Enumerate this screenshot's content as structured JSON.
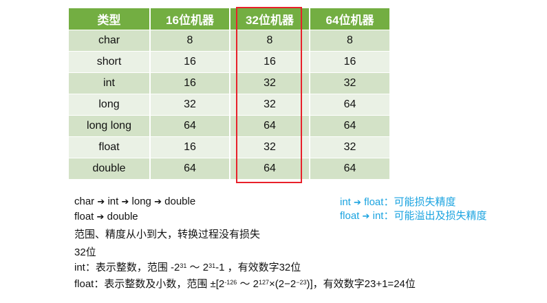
{
  "table": {
    "headers": [
      "类型",
      "16位机器",
      "32位机器",
      "64位机器"
    ],
    "rows": [
      [
        "char",
        "8",
        "8",
        "8"
      ],
      [
        "short",
        "16",
        "16",
        "16"
      ],
      [
        "int",
        "16",
        "32",
        "32"
      ],
      [
        "long",
        "32",
        "32",
        "64"
      ],
      [
        "long long",
        "64",
        "64",
        "64"
      ],
      [
        "float",
        "16",
        "32",
        "32"
      ],
      [
        "double",
        "64",
        "64",
        "64"
      ]
    ],
    "highlight_color": "#e8202a",
    "header_color": "#73ae42"
  },
  "notes": {
    "conv1": [
      "char",
      "int",
      "long",
      "double"
    ],
    "conv2": [
      "float",
      "double"
    ],
    "range_line": "范围、精度从小到大，转换过程没有损失",
    "bits_heading": "32位",
    "int_line": {
      "prefix": "int：表示整数，范围 -2",
      "exp1": "31",
      "mid": " ～ 2",
      "exp2": "31",
      "suffix": "-1 ，有效数字32位"
    },
    "float_line": {
      "prefix": "float：表示整数及小数，范围 ±[2",
      "exp1": "-126",
      "mid": " ～ 2",
      "exp2": "127",
      "mid2": "×(2−2",
      "exp3": "−23",
      "suffix": ")]，有效数字23+1=24位"
    }
  },
  "side_notes": {
    "line1": {
      "from": "int",
      "to": "float",
      "text": "：可能损失精度"
    },
    "line2": {
      "from": "float",
      "to": "int",
      "text": "：可能溢出及损失精度"
    },
    "color": "#1aa3e0"
  },
  "arrow_glyph": "➔"
}
